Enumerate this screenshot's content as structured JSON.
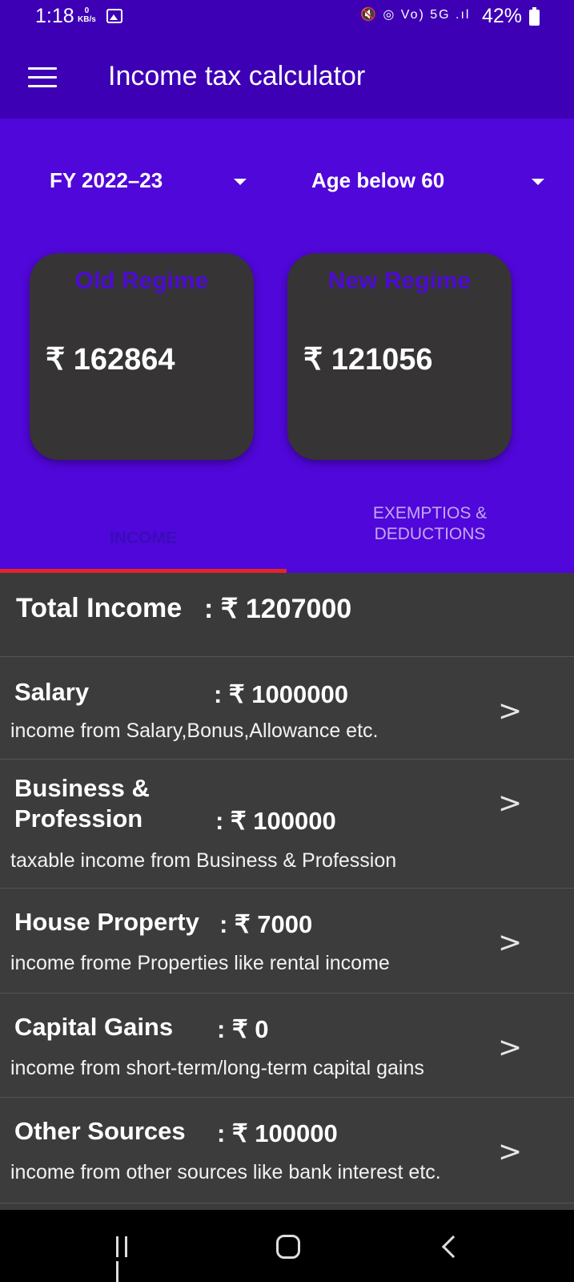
{
  "status_bar": {
    "time": "1:18",
    "net_speed_value": "0",
    "net_speed_unit": "KB/s",
    "signal_icons": "🔇 ◎ Vo) 5G .ıl",
    "battery_text": "42%"
  },
  "app_bar": {
    "title": "Income tax calculator",
    "menu_icon": "hamburger-icon"
  },
  "selectors": {
    "fy": "FY 2022–23",
    "age": "Age below 60"
  },
  "cards": {
    "old_title": "Old Regime",
    "old_amount": "₹ 162864",
    "new_title": "New Regime",
    "new_amount": "₹ 121056"
  },
  "tabs": {
    "income": "INCOME",
    "exemptions_line1": "EXEMPTIOS &",
    "exemptions_line2": "DEDUCTIONS"
  },
  "total": {
    "label": "Total Income",
    "value": ": ₹ 1207000"
  },
  "items": [
    {
      "label": "Salary",
      "value": ": ₹ 1000000",
      "desc": "income from Salary,Bonus,Allowance etc.",
      "chevron": ">"
    },
    {
      "label_line1": "Business &",
      "label_line2": "Profession",
      "value": ": ₹ 100000",
      "desc": "taxable income from Business & Profession",
      "chevron": ">"
    },
    {
      "label": "House Property",
      "value": ": ₹ 7000",
      "desc": "income frome Properties like rental income",
      "chevron": ">"
    },
    {
      "label": "Capital Gains",
      "value": ": ₹ 0",
      "desc": "income from short-term/long-term capital gains",
      "chevron": ">"
    },
    {
      "label": "Other Sources",
      "value": ": ₹ 100000",
      "desc": "income from other sources like bank interest etc.",
      "chevron": ">"
    }
  ],
  "colors": {
    "app_bar": "#3d00b4",
    "header": "#5007d9",
    "card": "#363435",
    "tab_indicator": "#e2242b",
    "list_bg": "#3c3c3c"
  }
}
